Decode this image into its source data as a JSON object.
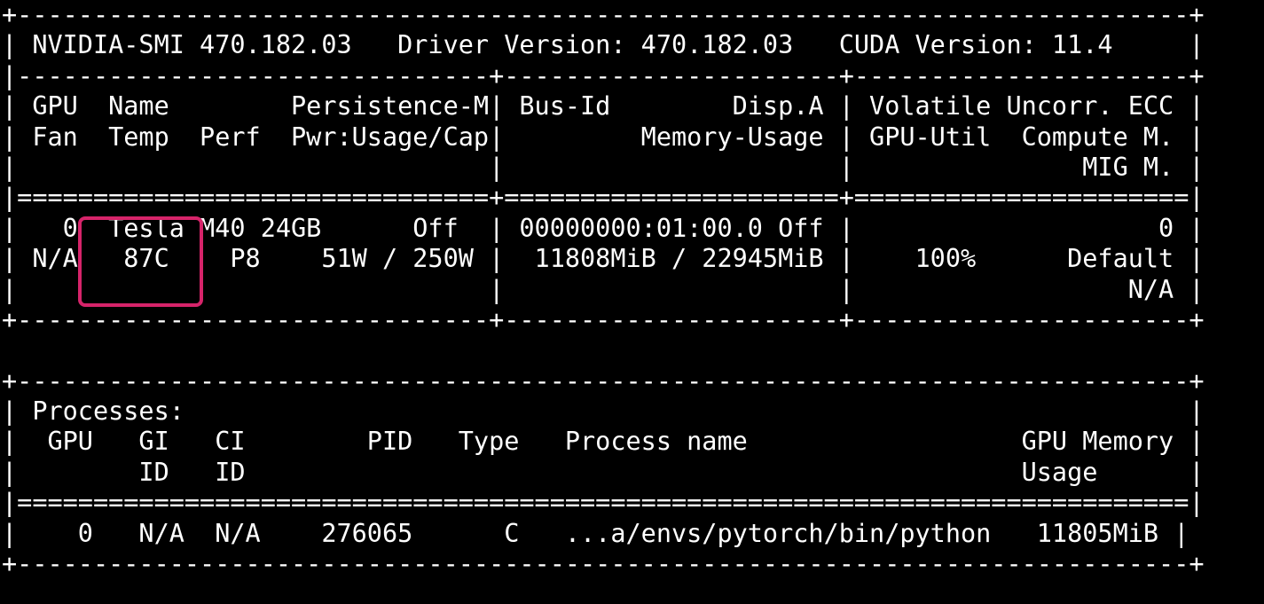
{
  "terminal": {
    "lines": [
      "+-----------------------------------------------------------------------------+",
      "| NVIDIA-SMI 470.182.03   Driver Version: 470.182.03   CUDA Version: 11.4     |",
      "|-------------------------------+----------------------+----------------------+",
      "| GPU  Name        Persistence-M| Bus-Id        Disp.A | Volatile Uncorr. ECC |",
      "| Fan  Temp  Perf  Pwr:Usage/Cap|         Memory-Usage | GPU-Util  Compute M. |",
      "|                               |                      |               MIG M. |",
      "|===============================+======================+======================|",
      "|   0  Tesla M40 24GB      Off  | 00000000:01:00.0 Off |                    0 |",
      "| N/A   87C    P8    51W / 250W |  11808MiB / 22945MiB |    100%      Default |",
      "|                               |                      |                  N/A |",
      "+-------------------------------+----------------------+----------------------+",
      "",
      "+-----------------------------------------------------------------------------+",
      "| Processes:                                                                  |",
      "|  GPU   GI   CI        PID   Type   Process name                  GPU Memory |",
      "|        ID   ID                                                   Usage      |",
      "|=============================================================================|",
      "|    0   N/A  N/A    276065      C   ...a/envs/pytorch/bin/python   11805MiB |",
      "+-----------------------------------------------------------------------------+"
    ]
  },
  "highlight": {
    "color": "#d6246a"
  }
}
